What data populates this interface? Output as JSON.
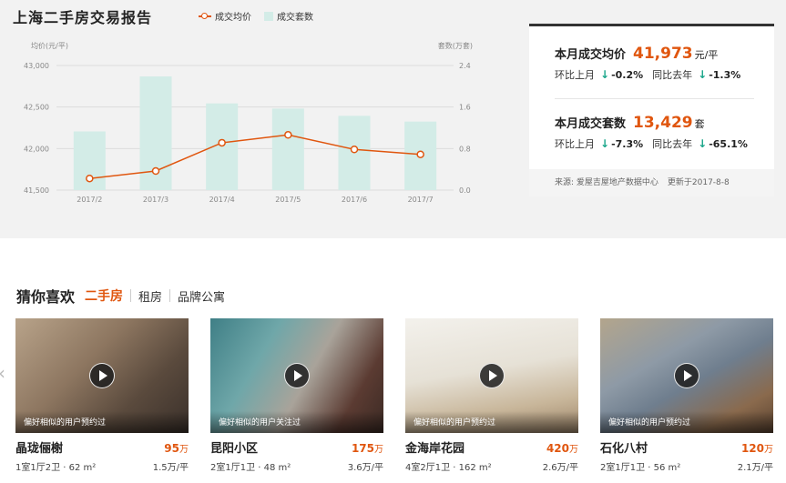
{
  "header": {
    "title": "上海二手房交易报告",
    "legend_price": "成交均价",
    "legend_count": "成交套数"
  },
  "chart_data": {
    "type": "bar+line",
    "categories": [
      "2017/2",
      "2017/3",
      "2017/4",
      "2017/5",
      "2017/6",
      "2017/7"
    ],
    "series": [
      {
        "name": "成交套数",
        "type": "bar",
        "axis": "right",
        "values": [
          1.13,
          2.19,
          1.67,
          1.57,
          1.43,
          1.32
        ]
      },
      {
        "name": "成交均价",
        "type": "line",
        "axis": "left",
        "values": [
          41640,
          41730,
          42070,
          42165,
          41990,
          41930
        ]
      }
    ],
    "y_left": {
      "label": "均价(元/平)",
      "ylim": [
        41500,
        43000
      ],
      "ticks": [
        "41,500",
        "42,000",
        "42,500",
        "43,000"
      ]
    },
    "y_right": {
      "label": "套数(万套)",
      "ylim": [
        0,
        2.4
      ],
      "ticks": [
        "0.0",
        "0.8",
        "1.6",
        "2.4"
      ]
    },
    "grid": true,
    "colors": {
      "bar": "#d3ece7",
      "line": "#e0560f"
    }
  },
  "stats": {
    "price_label": "本月成交均价",
    "price_value": "41,973",
    "price_unit": "元/平",
    "mom_label": "环比上月",
    "price_mom": "-0.2%",
    "yoy_label": "同比去年",
    "price_yoy": "-1.3%",
    "count_label": "本月成交套数",
    "count_value": "13,429",
    "count_unit": "套",
    "count_mom": "-7.3%",
    "count_yoy": "-65.1%",
    "source": "来源: 爱屋吉屋地产数据中心",
    "updated": "更新于2017-8-8"
  },
  "section": {
    "title": "猜你喜欢",
    "tabs": [
      "二手房",
      "租房",
      "品牌公寓"
    ]
  },
  "listings": [
    {
      "name": "晶珑俪榭",
      "price": "95",
      "price_unit": "万",
      "layout": "1室1厅2卫 · 62 m²",
      "unit_price": "1.5万/平",
      "caption": "偏好相似的用户预约过"
    },
    {
      "name": "昆阳小区",
      "price": "175",
      "price_unit": "万",
      "layout": "2室1厅1卫 · 48 m²",
      "unit_price": "3.6万/平",
      "caption": "偏好相似的用户关注过"
    },
    {
      "name": "金海岸花园",
      "price": "420",
      "price_unit": "万",
      "layout": "4室2厅1卫 · 162 m²",
      "unit_price": "2.6万/平",
      "caption": "偏好相似的用户预约过"
    },
    {
      "name": "石化八村",
      "price": "120",
      "price_unit": "万",
      "layout": "2室1厅1卫 · 56 m²",
      "unit_price": "2.1万/平",
      "caption": "偏好相似的用户预约过"
    }
  ],
  "colors": {
    "accent": "#e0560f",
    "down": "#1aa68a"
  },
  "icons": {
    "down_arrow": "down-arrow-icon",
    "play": "play-icon",
    "prev": "chevron-left-icon"
  }
}
